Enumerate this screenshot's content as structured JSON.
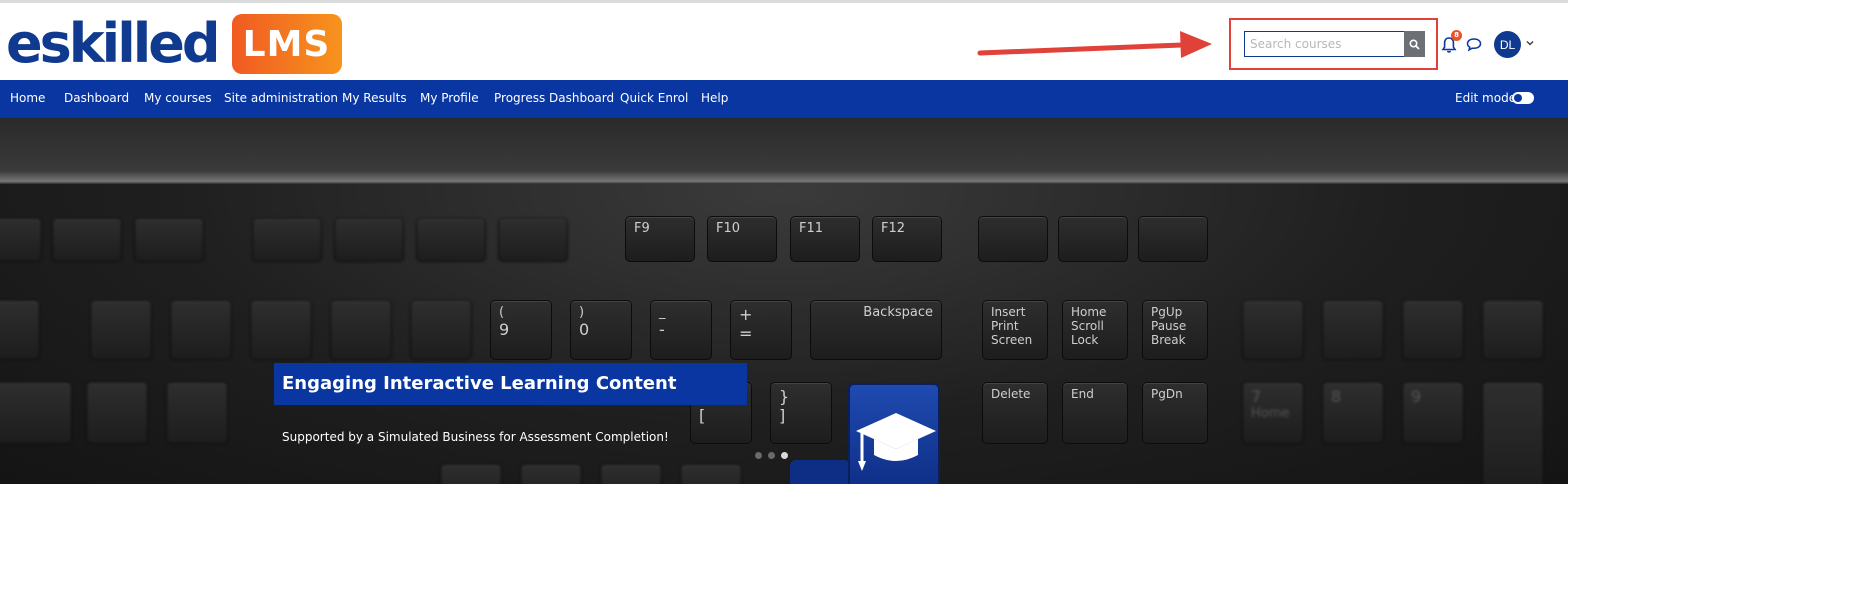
{
  "header": {
    "logo_text": "eskilled",
    "logo_badge": "LMS",
    "search": {
      "placeholder": "Search courses"
    },
    "notifications_count": "8",
    "avatar_initials": "DL"
  },
  "nav": {
    "items": [
      {
        "label": "Home"
      },
      {
        "label": "Dashboard"
      },
      {
        "label": "My courses"
      },
      {
        "label": "Site administration"
      },
      {
        "label": "My Results"
      },
      {
        "label": "My Profile"
      },
      {
        "label": "Progress Dashboard"
      },
      {
        "label": "Quick Enrol"
      },
      {
        "label": "Help"
      }
    ],
    "edit_mode_label": "Edit mode"
  },
  "hero": {
    "title": "Engaging Interactive Learning Content",
    "subtitle": "Supported by a Simulated Business for Assessment Completion!",
    "slide_count": 3,
    "active_slide": 3,
    "keys": {
      "f9": "F9",
      "f10": "F10",
      "f11": "F11",
      "f12": "F12",
      "backspace": "Backspace",
      "insert": "Insert",
      "print": "Print",
      "screen": "Screen",
      "home": "Home",
      "scroll": "Scroll",
      "lock": "Lock",
      "pgup": "PgUp",
      "pause": "Pause",
      "break": "Break",
      "delete": "Delete",
      "end": "End",
      "pgdn": "PgDn",
      "k9": "9",
      "lparen": "(",
      "k0": "0",
      "rparen": ")",
      "minus": "-",
      "underscore": "_",
      "plus": "+",
      "equals": "=",
      "lbrace": "{",
      "lbracket": "[",
      "rbrace": "}",
      "rbracket": "]",
      "n7": "7",
      "n8": "8",
      "n9": "9",
      "nhome": "Home"
    }
  },
  "colors": {
    "brand_blue": "#0a36a2",
    "brand_orange": "#f7941d",
    "highlight_red": "#e0423a"
  }
}
